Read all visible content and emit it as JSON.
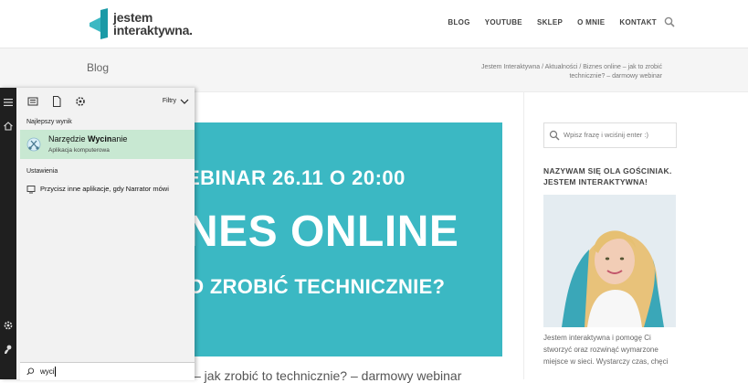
{
  "site": {
    "logo_line1": "jestem",
    "logo_line2": "interaktywna."
  },
  "nav": {
    "items": [
      "BLOG",
      "YOUTUBE",
      "SKLEP",
      "O MNIE",
      "KONTAKT"
    ],
    "search_icon": "search-icon"
  },
  "subbar": {
    "title": "Blog",
    "breadcrumb": "Jestem Interaktywna / Aktualności / Biznes online – jak to zrobić technicznie? – darmowy webinar"
  },
  "banner": {
    "line1": "EBINAR 26.11 O 20:00",
    "line2": "NES ONLINE",
    "line3": "O ZROBIĆ TECHNICZNIE?",
    "bg_color": "#3bb8c3"
  },
  "post_heading_fragment": "– jak zrobić to technicznie? – darmowy webinar",
  "sidebar": {
    "search_placeholder": "Wpisz frazę i wciśnij enter :)",
    "heading": "NAZYWAM SIĘ OLA GOŚCINIAK. JESTEM INTERAKTYWNA!",
    "bio": "Jestem interaktywna i pomogę Ci stworzyć oraz rozwinąć wymarzone miejsce w sieci. Wystarczy czas, chęci"
  },
  "start_panel": {
    "filters_label": "Filtry",
    "section_best": "Najlepszy wynik",
    "best_name_pre": "Narzędzie ",
    "best_name_bold": "Wycin",
    "best_name_post": "anie",
    "best_sub": "Aplikacja komputerowa",
    "section_settings": "Ustawienia",
    "settings_item": "Przycisz inne aplikacje, gdy Narrator mówi",
    "search_value": "wyci",
    "highlight_color": "#c8e8d2"
  }
}
